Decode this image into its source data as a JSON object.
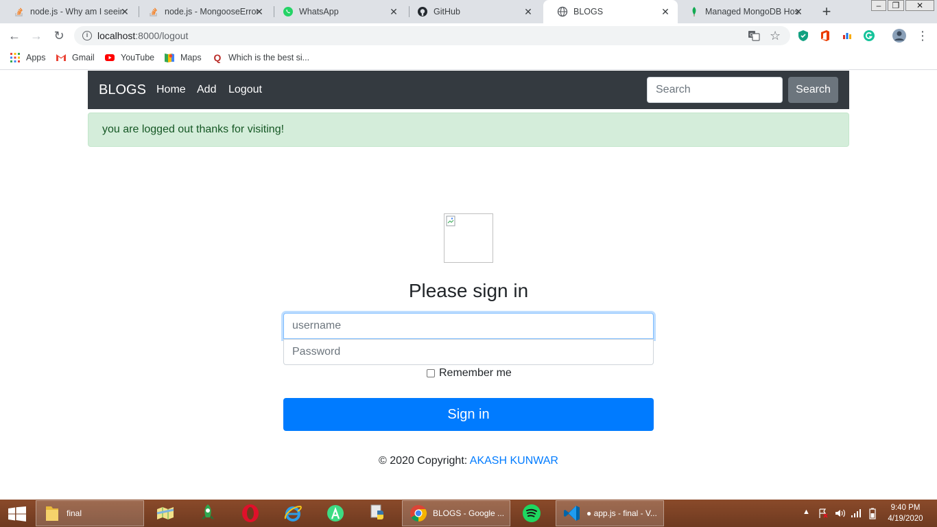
{
  "browser": {
    "tabs": [
      {
        "title": "node.js - Why am I seeing",
        "icon": "stackoverflow-icon"
      },
      {
        "title": "node.js - MongooseError",
        "icon": "stackoverflow-icon"
      },
      {
        "title": "WhatsApp",
        "icon": "whatsapp-icon"
      },
      {
        "title": "GitHub",
        "icon": "github-icon"
      },
      {
        "title": "BLOGS",
        "icon": "globe-icon",
        "active": true
      },
      {
        "title": "Managed MongoDB Hos",
        "icon": "mongodb-leaf-icon"
      }
    ],
    "new_tab": "+",
    "window_controls": {
      "minimize": "–",
      "restore": "❐",
      "close": "✕"
    },
    "url": {
      "host": "localhost",
      "path": ":8000/logout"
    },
    "bookmarks": [
      {
        "label": "Apps",
        "icon": "apps-grid-icon"
      },
      {
        "label": "Gmail",
        "icon": "gmail-icon"
      },
      {
        "label": "YouTube",
        "icon": "youtube-icon"
      },
      {
        "label": "Maps",
        "icon": "maps-icon"
      },
      {
        "label": "Which is the best si...",
        "icon": "quora-icon"
      }
    ]
  },
  "page": {
    "navbar": {
      "brand": "BLOGS",
      "links": [
        "Home",
        "Add",
        "Logout"
      ],
      "search_placeholder": "Search",
      "search_button": "Search"
    },
    "alert": "you are logged out thanks for visiting!",
    "form": {
      "title": "Please sign in",
      "username_placeholder": "username",
      "password_placeholder": "Password",
      "remember_label": "Remember me",
      "submit": "Sign in"
    },
    "footer": {
      "text": "© 2020 Copyright: ",
      "author": "AKASH KUNWAR"
    }
  },
  "taskbar": {
    "apps": [
      {
        "label": "final",
        "icon": "folder-icon"
      },
      {
        "label": "",
        "icon": "maps-app-icon"
      },
      {
        "label": "",
        "icon": "rocket-icon"
      },
      {
        "label": "",
        "icon": "opera-icon"
      },
      {
        "label": "",
        "icon": "internet-explorer-icon"
      },
      {
        "label": "",
        "icon": "android-studio-icon"
      },
      {
        "label": "",
        "icon": "python-icon"
      },
      {
        "label": "BLOGS - Google ...",
        "icon": "chrome-icon"
      },
      {
        "label": "",
        "icon": "spotify-icon"
      },
      {
        "label": "● app.js - final - V...",
        "icon": "vscode-icon"
      }
    ],
    "clock": {
      "time": "9:40 PM",
      "date": "4/19/2020"
    }
  },
  "colors": {
    "navbar": "#343a40",
    "alert_bg": "#d4edda",
    "alert_text": "#155724",
    "primary": "#007bff",
    "secondary": "#6c757d"
  }
}
